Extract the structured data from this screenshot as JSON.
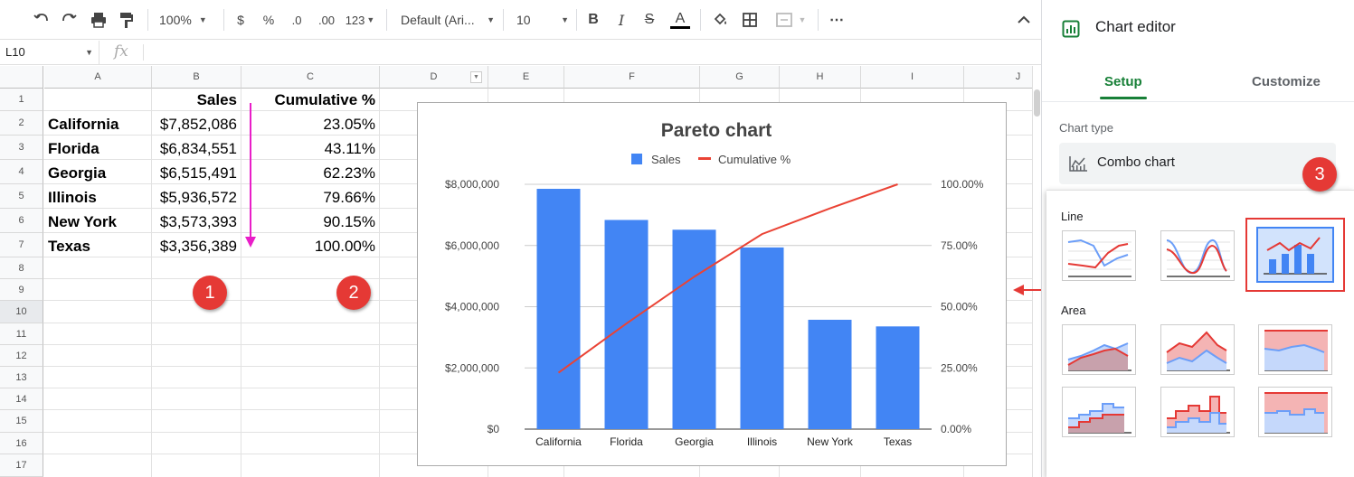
{
  "toolbar": {
    "zoom": "100%",
    "currency": "$",
    "percent": "%",
    "decrease_decimals": ".0",
    "increase_decimals": ".00",
    "more_formats": "123",
    "font_family": "Default (Ari...",
    "font_size": "10",
    "bold": "B",
    "italic": "I",
    "strikethrough": "S",
    "text_color": "A",
    "more": "⋯"
  },
  "formula_bar": {
    "cell_ref": "L10",
    "fx": "fx"
  },
  "grid": {
    "columns": [
      "A",
      "B",
      "C",
      "D",
      "E",
      "F",
      "G",
      "H",
      "I",
      "J"
    ],
    "rows": [
      "1",
      "2",
      "3",
      "4",
      "5",
      "6",
      "7",
      "8",
      "9",
      "10",
      "11",
      "12",
      "13",
      "14",
      "15",
      "16",
      "17"
    ],
    "selected_row": "10",
    "header": {
      "sales": "Sales",
      "cumulative": "Cumulative %"
    },
    "data": [
      {
        "state": "California",
        "sales": "$7,852,086",
        "cumulative": "23.05%"
      },
      {
        "state": "Florida",
        "sales": "$6,834,551",
        "cumulative": "43.11%"
      },
      {
        "state": "Georgia",
        "sales": "$6,515,491",
        "cumulative": "62.23%"
      },
      {
        "state": "Illinois",
        "sales": "$5,936,572",
        "cumulative": "79.66%"
      },
      {
        "state": "New York",
        "sales": "$3,573,393",
        "cumulative": "90.15%"
      },
      {
        "state": "Texas",
        "sales": "$3,356,389",
        "cumulative": "100.00%"
      }
    ]
  },
  "markers": {
    "one": "1",
    "two": "2",
    "three": "3"
  },
  "colors": {
    "bar": "#4285f4",
    "line": "#ea4335",
    "marker": "#e53935",
    "annotation_arrow": "#e91ec8",
    "setup_tab": "#188038"
  },
  "chart_data": {
    "type": "bar",
    "title": "Pareto chart",
    "categories": [
      "California",
      "Florida",
      "Georgia",
      "Illinois",
      "New York",
      "Texas"
    ],
    "series": [
      {
        "name": "Sales",
        "type": "bar",
        "axis": "left",
        "values": [
          7852086,
          6834551,
          6515491,
          5936572,
          3573393,
          3356389
        ]
      },
      {
        "name": "Cumulative %",
        "type": "line",
        "axis": "right",
        "values": [
          23.05,
          43.11,
          62.23,
          79.66,
          90.15,
          100.0
        ]
      }
    ],
    "ylim": [
      0,
      8000000
    ],
    "y2lim": [
      0,
      100
    ],
    "y_ticks": [
      "$0",
      "$2,000,000",
      "$4,000,000",
      "$6,000,000",
      "$8,000,000"
    ],
    "y2_ticks": [
      "0.00%",
      "25.00%",
      "50.00%",
      "75.00%",
      "100.00%"
    ],
    "legend": "top",
    "grid": true
  },
  "editor": {
    "title": "Chart editor",
    "tabs": {
      "setup": "Setup",
      "customize": "Customize"
    },
    "chart_type_label": "Chart type",
    "chart_type_value": "Combo chart",
    "sections": {
      "line": "Line",
      "area": "Area"
    }
  }
}
